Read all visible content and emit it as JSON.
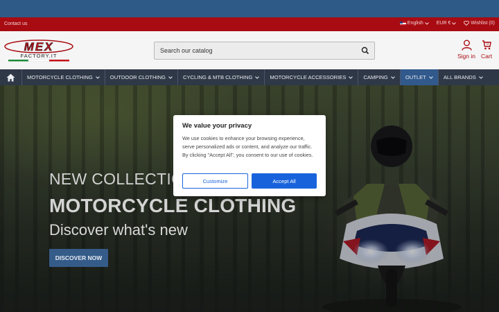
{
  "topbar": {
    "contact": "Contact us",
    "language": "English",
    "currency": "EUR €",
    "wishlist": "Wishlist (0)"
  },
  "header": {
    "logo_main": "MEX",
    "logo_sub": "FACTORY.IT",
    "search_placeholder": "Search our catalog",
    "signin": "Sign in",
    "cart": "Cart",
    "cart_count": "0"
  },
  "nav": {
    "items": [
      {
        "label": "MOTORCYCLE CLOTHING"
      },
      {
        "label": "OUTDOOR CLOTHING"
      },
      {
        "label": "CYCLING & MTB CLOTHING"
      },
      {
        "label": "MOTORCYCLE ACCESSORIES"
      },
      {
        "label": "CAMPING"
      },
      {
        "label": "OUTLET"
      },
      {
        "label": "ALL BRANDS"
      }
    ]
  },
  "hero": {
    "line1": "NEW COLLECTION 2",
    "line2": "MOTORCYCLE CLOTHING",
    "line3": "Discover what's new",
    "cta": "DISCOVER NOW"
  },
  "cookie": {
    "title": "We value your privacy",
    "text": "We use cookies to enhance your browsing experience, serve personalized ads or content, and analyze our traffic. By clicking \"Accept All\", you consent to our use of cookies.",
    "customize": "Customize",
    "accept": "Accept All"
  },
  "colors": {
    "brand_red": "#a80b12",
    "nav_bg": "#2f3847",
    "nav_active": "#31598c",
    "accent_blue": "#1863dc"
  }
}
